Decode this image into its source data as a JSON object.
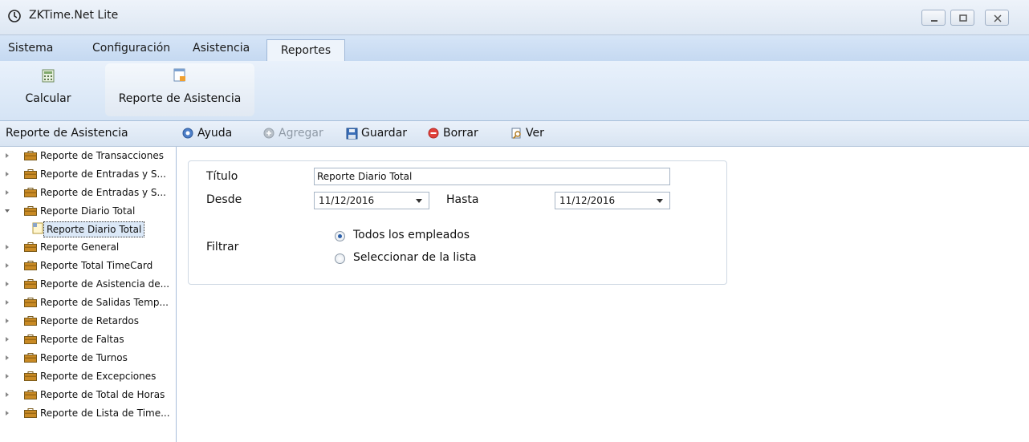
{
  "window": {
    "title": "ZKTime.Net Lite",
    "controls": {
      "minimize": "minimize-icon",
      "maximize": "maximize-icon",
      "close": "close-icon"
    }
  },
  "menu": {
    "items": [
      {
        "label": "Sistema"
      },
      {
        "label": "Configuración"
      },
      {
        "label": "Asistencia"
      },
      {
        "label": "Reportes",
        "active": true
      }
    ]
  },
  "ribbon": {
    "buttons": [
      {
        "label": "Calcular",
        "icon": "calculator-icon"
      },
      {
        "label": "Reporte de Asistencia",
        "icon": "report-icon",
        "active": true
      }
    ]
  },
  "left_panel": {
    "header": "Reporte de Asistencia",
    "tree": [
      {
        "label": "Reporte de Transacciones",
        "expanded": false
      },
      {
        "label": "Reporte de Entradas y S...",
        "expanded": false
      },
      {
        "label": "Reporte de Entradas y S...",
        "expanded": false
      },
      {
        "label": "Reporte Diario Total",
        "expanded": true
      },
      {
        "label": "Reporte General",
        "expanded": false
      },
      {
        "label": "Reporte Total TimeCard",
        "expanded": false
      },
      {
        "label": "Reporte de Asistencia de...",
        "expanded": false
      },
      {
        "label": "Reporte de Salidas Temp...",
        "expanded": false
      },
      {
        "label": "Reporte de Retardos",
        "expanded": false
      },
      {
        "label": "Reporte de Faltas",
        "expanded": false
      },
      {
        "label": "Reporte de Turnos",
        "expanded": false
      },
      {
        "label": "Reporte de Excepciones",
        "expanded": false
      },
      {
        "label": "Reporte de Total de Horas",
        "expanded": false
      },
      {
        "label": "Reporte de Lista de Time...",
        "expanded": false
      }
    ],
    "selected_child": "Reporte Diario Total"
  },
  "toolbar": {
    "ayuda": "Ayuda",
    "agregar": "Agregar",
    "guardar": "Guardar",
    "borrar": "Borrar",
    "ver": "Ver"
  },
  "form": {
    "titulo_label": "Título",
    "titulo_value": "Reporte Diario Total",
    "desde_label": "Desde",
    "desde_value": "11/12/2016",
    "hasta_label": "Hasta",
    "hasta_value": "11/12/2016",
    "filtrar_label": "Filtrar",
    "option_all": "Todos los empleados",
    "option_select": "Seleccionar de la lista",
    "selected_option": "Todos los empleados"
  },
  "colors": {
    "menubar": "#c5d9f1",
    "ribbon": "#d5e4f5",
    "accent": "#2a5ea8",
    "delete": "#e0403a"
  }
}
